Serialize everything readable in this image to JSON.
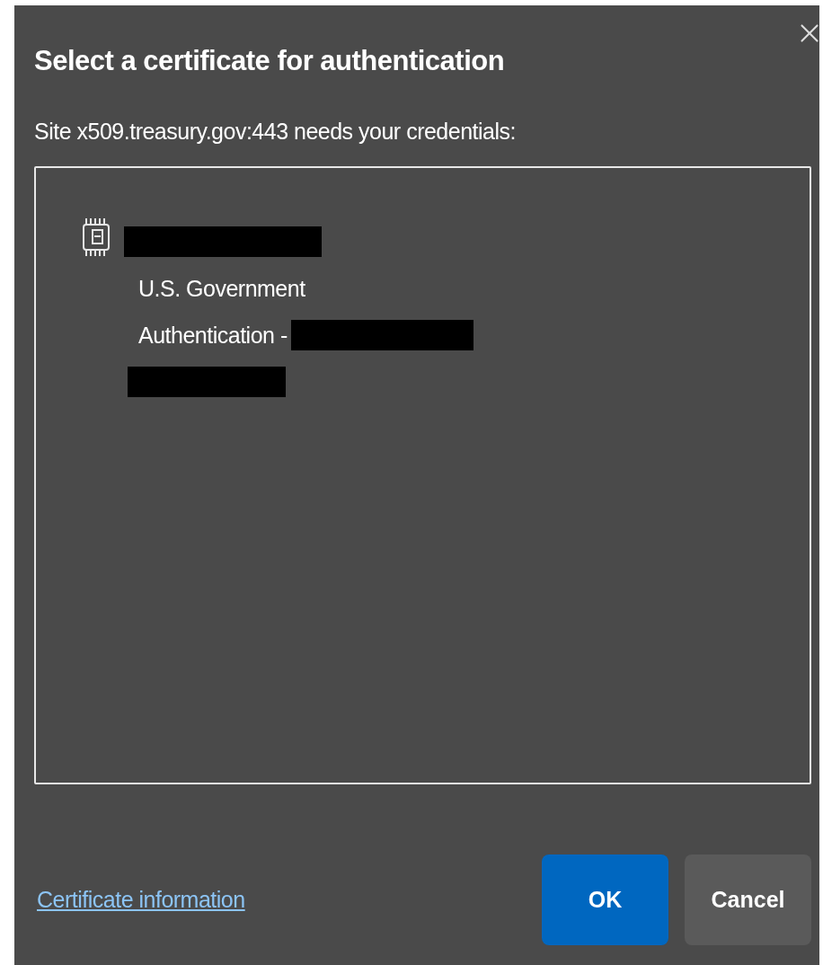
{
  "dialog": {
    "title": "Select a certificate for authentication",
    "message": "Site x509.treasury.gov:443 needs your credentials:",
    "certificates": [
      {
        "lines": [
          {
            "kind": "redacted"
          },
          {
            "kind": "text",
            "text": "U.S. Government"
          },
          {
            "kind": "text_redacted",
            "text": "Authentication -"
          },
          {
            "kind": "redacted"
          }
        ]
      }
    ],
    "link": "Certificate information",
    "buttons": [
      {
        "label": "OK",
        "kind": "primary"
      },
      {
        "label": "Cancel",
        "kind": "secondary"
      }
    ]
  }
}
